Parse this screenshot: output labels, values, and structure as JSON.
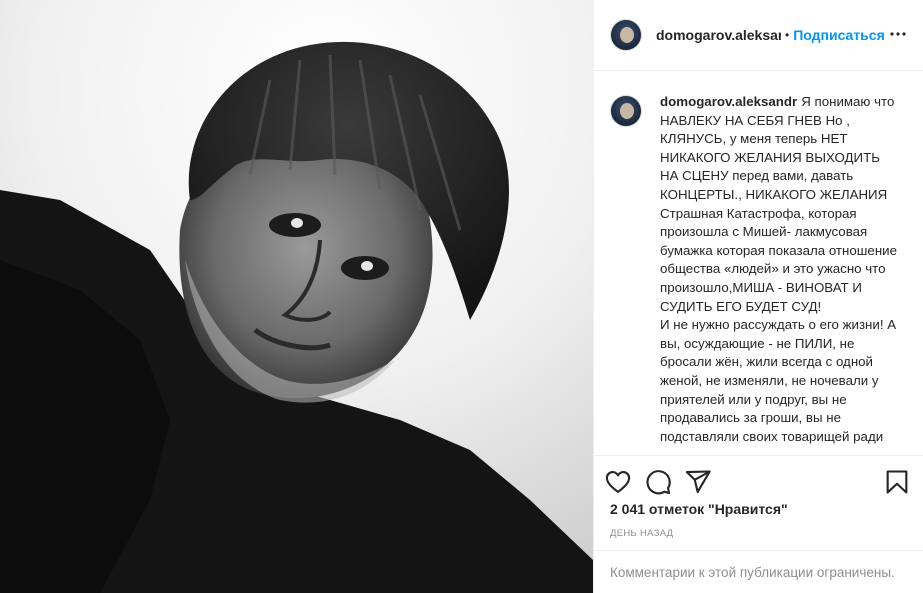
{
  "post": {
    "image_alt_icon": "portrait-photo",
    "header": {
      "username": "domogarov.aleksan",
      "separator": "•",
      "follow_label": "Подписаться",
      "more_icon": "more-icon"
    },
    "caption": {
      "username": "domogarov.aleksandr",
      "text": "Я понимаю что НАВЛЕКУ НА СЕБЯ ГНЕВ Но , КЛЯНУСЬ, у меня теперь НЕТ НИКАКОГО ЖЕЛАНИЯ ВЫХОДИТЬ НА СЦЕНУ перед вами, давать КОНЦЕРТЫ., НИКАКОГО ЖЕЛАНИЯ Страшная Катастрофа, которая произошла с Мишей- лакмусовая бумажка которая показала отношение общества «людей» и это ужасно что произошло,МИША - ВИНОВАТ И СУДИТЬ ЕГО БУДЕТ СУД!\nИ не нужно рассуждать о его жизни! А вы, осуждающие - не ПИЛИ, не бросали жён, жили всегда с одной женой, не изменяли, не ночевали у приятелей или у подруг, вы не продавались за гроши, вы не подставляли своих товарищей ради"
    },
    "actions": {
      "like_icon": "heart-icon",
      "comment_icon": "comment-icon",
      "share_icon": "share-icon",
      "save_icon": "bookmark-icon"
    },
    "likes_text": "2 041 отметок \"Нравится\"",
    "timestamp": "День назад",
    "comments_limited": "Комментарии к этой публикации ограничены."
  },
  "colors": {
    "follow_blue": "#0095f6",
    "text": "#262626",
    "secondary": "#8e8e8e",
    "border": "#efefef"
  }
}
